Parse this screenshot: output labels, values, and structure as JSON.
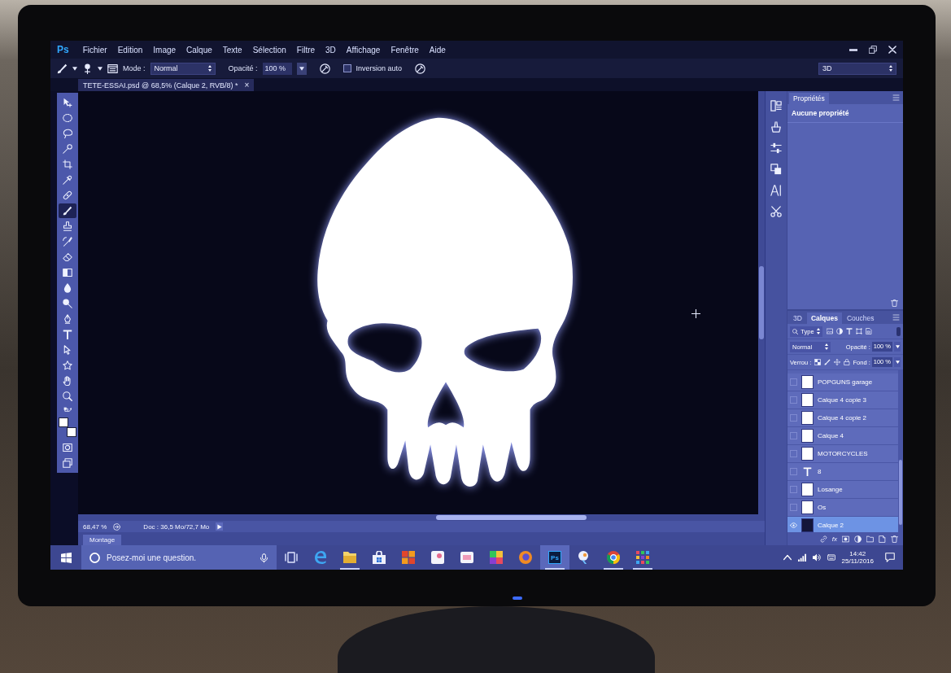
{
  "menu_bar": {
    "logo": "Ps",
    "items": [
      "Fichier",
      "Edition",
      "Image",
      "Calque",
      "Texte",
      "Sélection",
      "Filtre",
      "3D",
      "Affichage",
      "Fenêtre",
      "Aide"
    ],
    "window_controls": [
      {
        "kind": "minimize"
      },
      {
        "kind": "restore"
      },
      {
        "kind": "close"
      }
    ]
  },
  "options_bar": {
    "mode_label": "Mode :",
    "mode_value": "Normal",
    "opacity_label": "Opacité :",
    "opacity_value": "100 %",
    "auto_erase": {
      "label": "Inversion auto",
      "checked": false
    },
    "workspace": "3D"
  },
  "document_tab": {
    "title": "TETE-ESSAI.psd @ 68,5% (Calque 2, RVB/8) *",
    "close": "×"
  },
  "toolbar": {
    "tools": [
      {
        "kind": "move",
        "selected": false
      },
      {
        "kind": "marquee",
        "selected": false
      },
      {
        "kind": "lasso",
        "selected": false
      },
      {
        "kind": "quick_select",
        "selected": false
      },
      {
        "kind": "crop",
        "selected": false
      },
      {
        "kind": "eyedropper",
        "selected": false
      },
      {
        "kind": "heal",
        "selected": false
      },
      {
        "kind": "brush",
        "selected": true
      },
      {
        "kind": "stamp",
        "selected": false
      },
      {
        "kind": "history_brush",
        "selected": false
      },
      {
        "kind": "eraser",
        "selected": false
      },
      {
        "kind": "gradient",
        "selected": false
      },
      {
        "kind": "blur",
        "selected": false
      },
      {
        "kind": "dodge",
        "selected": false
      },
      {
        "kind": "pen",
        "selected": false
      },
      {
        "kind": "type",
        "selected": false
      },
      {
        "kind": "path_select",
        "selected": false
      },
      {
        "kind": "shape",
        "selected": false
      },
      {
        "kind": "hand",
        "selected": false
      },
      {
        "kind": "zoom",
        "selected": false
      }
    ],
    "swatches": [
      {
        "color": "#ffffff"
      },
      {
        "color": "#ffffff"
      }
    ],
    "modes": [
      {
        "kind": "quick_mask"
      },
      {
        "kind": "screen_mode"
      }
    ]
  },
  "panel_icons": [
    {
      "kind": "history"
    },
    {
      "kind": "brush_presets"
    },
    {
      "kind": "adjustments"
    },
    {
      "kind": "layer_comps"
    },
    {
      "kind": "character"
    },
    {
      "kind": "tool_presets"
    }
  ],
  "properties": {
    "tab": "Propriétés",
    "message": "Aucune propriété"
  },
  "layers_panel": {
    "tabs": [
      {
        "label": "3D",
        "selected": false
      },
      {
        "label": "Calques",
        "selected": true
      },
      {
        "label": "Couches",
        "selected": false
      }
    ],
    "filter": "Type",
    "blend_mode": "Normal",
    "opacity_label": "Opacité :",
    "opacity_value": "100 %",
    "lock_label": "Verrou :",
    "fill_label": "Fond :",
    "fill_value": "100 %",
    "layers": [
      {
        "name": "POPGUNS garage",
        "kind": "pixel",
        "color": "#ffffff",
        "visible": false,
        "selected": false
      },
      {
        "name": "Calque 4 copie 3",
        "kind": "pixel",
        "color": "#ffffff",
        "visible": false,
        "selected": false
      },
      {
        "name": "Calque 4 copie 2",
        "kind": "pixel",
        "color": "#ffffff",
        "visible": false,
        "selected": false
      },
      {
        "name": "Calque 4",
        "kind": "pixel",
        "color": "#ffffff",
        "visible": false,
        "selected": false
      },
      {
        "name": "MOTORCYCLES",
        "kind": "pixel",
        "color": "#ffffff",
        "visible": false,
        "selected": false
      },
      {
        "name": "8",
        "kind": "text",
        "visible": false,
        "selected": false
      },
      {
        "name": "Losange",
        "kind": "pixel",
        "color": "#ffffff",
        "visible": false,
        "selected": false
      },
      {
        "name": "Os",
        "kind": "pixel",
        "color": "#ffffff",
        "visible": false,
        "selected": false
      },
      {
        "name": "Calque 2",
        "kind": "pixel",
        "color": "#14163a",
        "visible": true,
        "selected": true
      }
    ],
    "footer_buttons": [
      {
        "kind": "link"
      },
      {
        "kind": "fx",
        "label": "fx"
      },
      {
        "kind": "mask"
      },
      {
        "kind": "adjustment"
      },
      {
        "kind": "group"
      },
      {
        "kind": "new"
      },
      {
        "kind": "delete"
      }
    ]
  },
  "status_bar": {
    "zoom": "68,47 %",
    "doc": "Doc : 36,5 Mo/72,7 Mo"
  },
  "timeline_tab": "Montage",
  "taskbar": {
    "search": {
      "placeholder": "Posez-moi une question."
    },
    "apps": [
      {
        "kind": "task_view",
        "running": false,
        "selected": false
      },
      {
        "kind": "edge",
        "running": false,
        "selected": false
      },
      {
        "kind": "explorer",
        "running": true,
        "selected": false
      },
      {
        "kind": "store",
        "running": false,
        "selected": false
      },
      {
        "kind": "office",
        "running": false,
        "selected": false
      },
      {
        "kind": "notes",
        "running": false,
        "selected": false
      },
      {
        "kind": "app",
        "running": false,
        "selected": false
      },
      {
        "kind": "colors",
        "running": false,
        "selected": false
      },
      {
        "kind": "firefox",
        "running": false,
        "selected": false
      },
      {
        "kind": "photoshop",
        "label": "Ps",
        "running": true,
        "selected": true
      },
      {
        "kind": "paint",
        "running": false,
        "selected": false
      },
      {
        "kind": "chrome",
        "running": true,
        "selected": false
      },
      {
        "kind": "grid",
        "running": true,
        "selected": false
      }
    ],
    "time": "14:42",
    "date": "25/11/2016"
  }
}
